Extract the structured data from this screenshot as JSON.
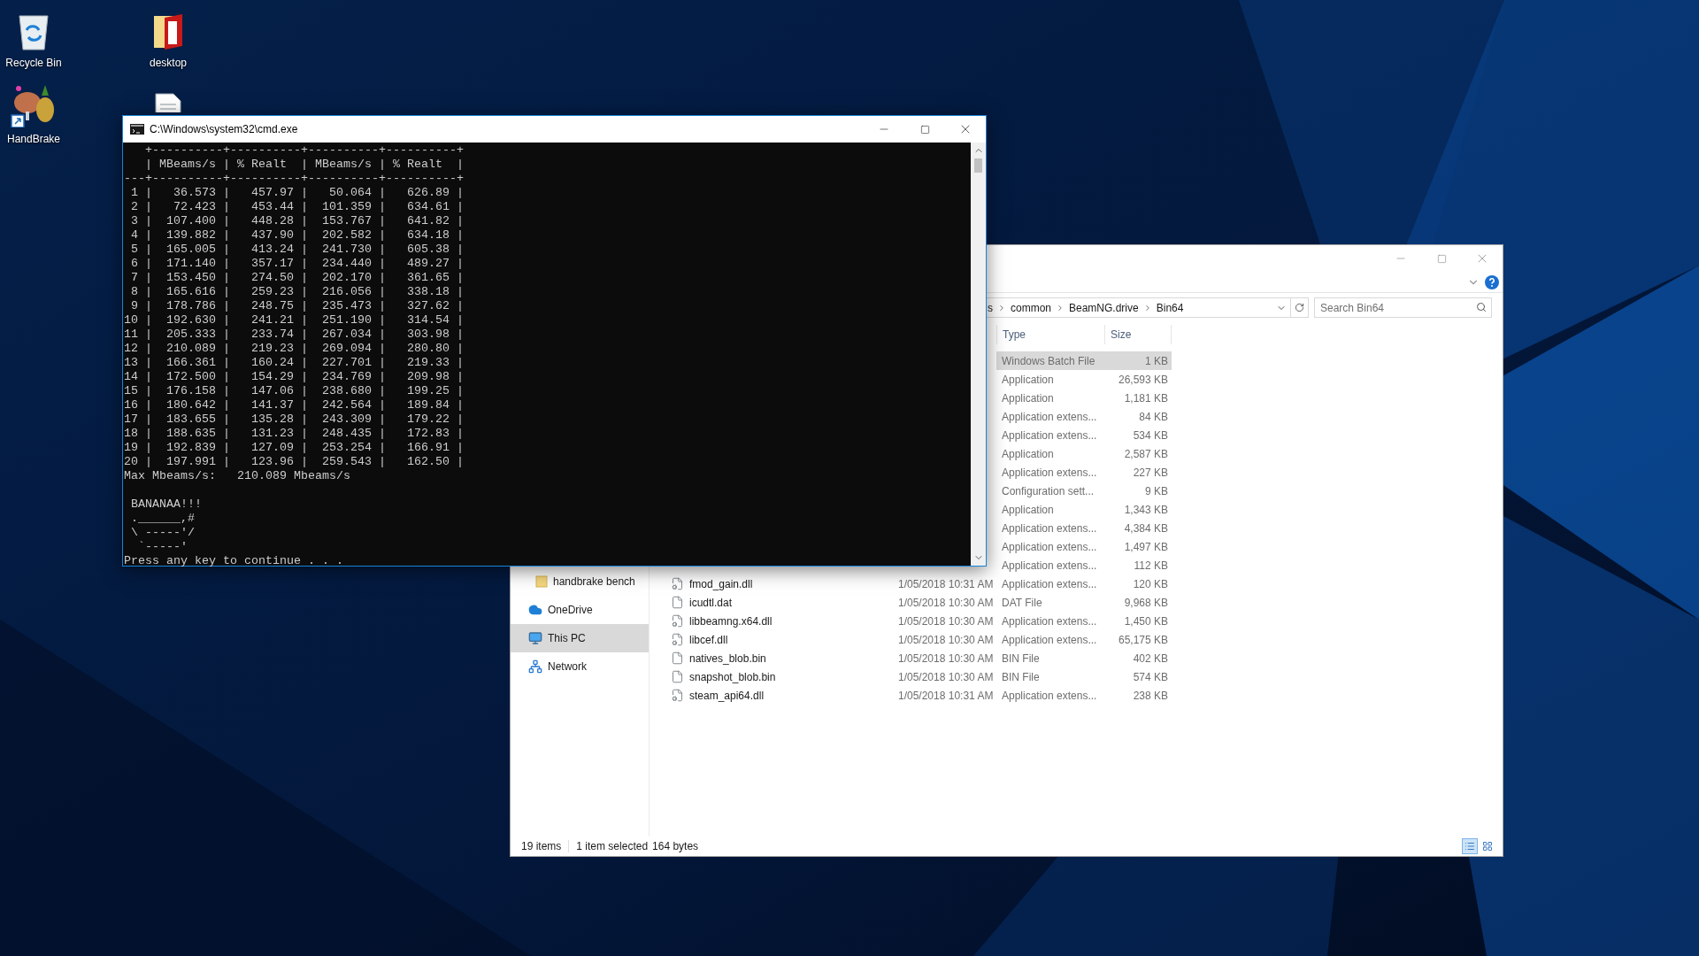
{
  "desktop": {
    "icons": [
      {
        "kind": "recycle",
        "label": "Recycle Bin"
      },
      {
        "kind": "folder",
        "label": "desktop"
      },
      {
        "kind": "app",
        "label": "HandBrake",
        "shortcut": true
      },
      {
        "kind": "document"
      }
    ]
  },
  "explorer": {
    "address": {
      "crumbs": [
        "s",
        "common",
        "BeamNG.drive",
        "Bin64"
      ]
    },
    "search": {
      "placeholder": "Search Bin64"
    },
    "nav": [
      {
        "kind": "folder",
        "label": "handbrake bench",
        "selected": false
      },
      {
        "kind": "cloud",
        "label": "OneDrive",
        "selected": false
      },
      {
        "kind": "pc",
        "label": "This PC",
        "selected": true
      },
      {
        "kind": "network",
        "label": "Network",
        "selected": false
      }
    ],
    "columns": [
      "Type",
      "Size"
    ],
    "rows": [
      {
        "type": "Windows Batch File",
        "size": "1 KB",
        "selected": true
      },
      {
        "type": "Application",
        "size": "26,593 KB",
        "selected": false
      },
      {
        "type": "Application",
        "size": "1,181 KB",
        "selected": false
      },
      {
        "type": "Application extens...",
        "size": "84 KB",
        "selected": false
      },
      {
        "type": "Application extens...",
        "size": "534 KB",
        "selected": false
      },
      {
        "type": "Application",
        "size": "2,587 KB",
        "selected": false
      },
      {
        "type": "Application extens...",
        "size": "227 KB",
        "selected": false
      },
      {
        "type": "Configuration sett...",
        "size": "9 KB",
        "selected": false
      },
      {
        "type": "Application",
        "size": "1,343 KB",
        "selected": false
      },
      {
        "type": "Application extens...",
        "size": "4,384 KB",
        "selected": false
      },
      {
        "type": "Application extens...",
        "size": "1,497 KB",
        "selected": false
      },
      {
        "type": "Application extens...",
        "size": "112 KB",
        "selected": false
      },
      {
        "kind": "dll",
        "name": "fmod_gain.dll",
        "date": "1/05/2018 10:31 AM",
        "type": "Application extens...",
        "size": "120 KB",
        "selected": false
      },
      {
        "kind": "file",
        "name": "icudtl.dat",
        "date": "1/05/2018 10:30 AM",
        "type": "DAT File",
        "size": "9,968 KB",
        "selected": false
      },
      {
        "kind": "dll",
        "name": "libbeamng.x64.dll",
        "date": "1/05/2018 10:30 AM",
        "type": "Application extens...",
        "size": "1,450 KB",
        "selected": false
      },
      {
        "kind": "dll",
        "name": "libcef.dll",
        "date": "1/05/2018 10:30 AM",
        "type": "Application extens...",
        "size": "65,175 KB",
        "selected": false
      },
      {
        "kind": "file",
        "name": "natives_blob.bin",
        "date": "1/05/2018 10:30 AM",
        "type": "BIN File",
        "size": "402 KB",
        "selected": false
      },
      {
        "kind": "file",
        "name": "snapshot_blob.bin",
        "date": "1/05/2018 10:30 AM",
        "type": "BIN File",
        "size": "574 KB",
        "selected": false
      },
      {
        "kind": "dll",
        "name": "steam_api64.dll",
        "date": "1/05/2018 10:31 AM",
        "type": "Application extens...",
        "size": "238 KB",
        "selected": false
      }
    ],
    "status": {
      "count": "19 items",
      "selection": "1 item selected",
      "selection_size": "164 bytes"
    },
    "views": [
      {
        "kind": "details",
        "selected": true
      },
      {
        "kind": "tiles",
        "selected": false
      }
    ]
  },
  "console": {
    "title": "C:\\Windows\\system32\\cmd.exe",
    "blocks": [
      [
        "   +----------+----------+----------+----------+",
        "   | MBeams/s | % Realt  | MBeams/s | % Realt  |",
        "---+----------+----------+----------+----------+",
        " 1 |   36.573 |   457.97 |   50.064 |   626.89 |",
        " 2 |   72.423 |   453.44 |  101.359 |   634.61 |",
        " 3 |  107.400 |   448.28 |  153.767 |   641.82 |",
        " 4 |  139.882 |   437.90 |  202.582 |   634.18 |",
        " 5 |  165.005 |   413.24 |  241.730 |   605.38 |",
        " 6 |  171.140 |   357.17 |  234.440 |   489.27 |",
        " 7 |  153.450 |   274.50 |  202.170 |   361.65 |",
        " 8 |  165.616 |   259.23 |  216.056 |   338.18 |",
        " 9 |  178.786 |   248.75 |  235.473 |   327.62 |",
        "10 |  192.630 |   241.21 |  251.190 |   314.54 |",
        "11 |  205.333 |   233.74 |  267.034 |   303.98 |",
        "12 |  210.089 |   219.23 |  269.094 |   280.80 |",
        "13 |  166.361 |   160.24 |  227.701 |   219.33 |",
        "14 |  172.500 |   154.29 |  234.769 |   209.98 |",
        "15 |  176.158 |   147.06 |  238.680 |   199.25 |",
        "16 |  180.642 |   141.37 |  242.564 |   189.84 |",
        "17 |  183.655 |   135.28 |  243.309 |   179.22 |",
        "18 |  188.635 |   131.23 |  248.435 |   172.83 |",
        "19 |  192.839 |   127.09 |  253.254 |   166.91 |",
        "20 |  197.991 |   123.96 |  259.543 |   162.50 |",
        "Max Mbeams/s:   210.089 Mbeams/s"
      ],
      [
        " BANANAA!!!",
        " .______,#",
        " \\ -----'/",
        "  `-----'",
        "Press any key to continue . . ."
      ]
    ]
  }
}
